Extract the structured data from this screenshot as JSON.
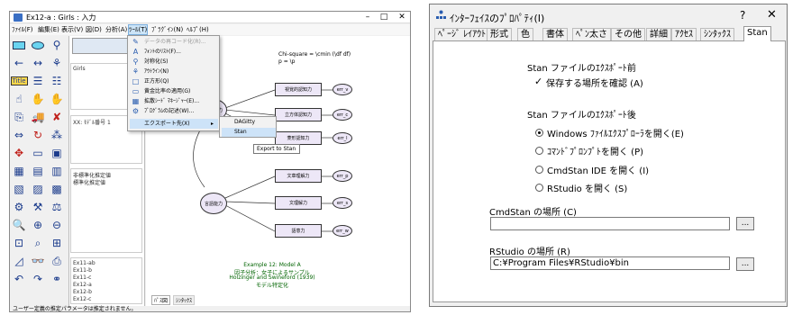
{
  "amos": {
    "title": "Ex12-a : Girls : 入力",
    "menu": [
      "ﾌｧｲﾙ(F)",
      "編集(E)",
      "表示(V)",
      "図(D)",
      "分析(A)",
      "ﾂｰﾙ(T)",
      "ﾌﾟﾗｸﾞｲﾝ(N)",
      "ﾍﾙﾌﾟ(H)"
    ],
    "panel": {
      "group": "Girls",
      "model": "XX: ﾓﾃﾞﾙ番号 1",
      "estimates": [
        "非標準化推定値",
        "標準化推定値"
      ],
      "files": [
        "Ex11-ab",
        "Ex11-b",
        "Ex11-c",
        "Ex12-a",
        "Ex12-b",
        "Ex12-c"
      ]
    },
    "tools_menu": {
      "items": [
        {
          "label": "データの再コード化(R)...",
          "disabled": true
        },
        {
          "label": "ﾌｫﾝﾄのﾘｽﾄ(F)..."
        },
        {
          "label": "対称化(S)"
        },
        {
          "label": "ｱｳﾄﾗｲﾝ(N)"
        },
        {
          "label": "正方形(Q)"
        },
        {
          "label": "黄金比率の適用(G)"
        },
        {
          "label": "拡散ｼｰﾄﾞ ﾏﾈｰｼﾞｬｰ(E)..."
        },
        {
          "label": "ﾌﾟﾛｸﾞﾗﾑの記述(W)..."
        },
        {
          "label": "エクスポート先(X)",
          "highlighted": true
        }
      ],
      "submenu": [
        "DAGitty",
        "Stan"
      ],
      "tooltip": "Export to Stan"
    },
    "diagram": {
      "header_lines": [
        "Chi-square = \\cmin (\\df df)",
        "p = \\p"
      ],
      "factors": [
        "空間能力",
        "言語能力"
      ],
      "observed": [
        "視覚的認知力",
        "立方体認知力",
        "菱形認知力",
        "文章理解力",
        "文理解力",
        "語意力"
      ],
      "errors": [
        "err_v",
        "err_c",
        "err_l",
        "err_p",
        "err_s",
        "err_w"
      ],
      "caption": [
        "Example 12: Model A",
        "因子分析：女子によるサンプル",
        "Holzinger and Swineford (1939)",
        "モデル特定化"
      ]
    },
    "canvas_tabs": [
      "ﾊﾟｽ図",
      "ｼﾝﾀｯｸｽ"
    ],
    "status": "ユーザー定義の推定パラメータは推定されません。"
  },
  "dialog": {
    "title": "ｲﾝﾀｰﾌｪｲｽのﾌﾟﾛﾊﾟﾃｨ(I)",
    "help": "?",
    "close": "✕",
    "tabs": [
      "ﾍﾟｰｼﾞ ﾚｲｱｳﾄ",
      "形式",
      "色",
      "書体",
      "ﾍﾟﾝ太さ",
      "その他",
      "詳細",
      "ｱｸｾｽ",
      "ｼﾝﾀｯｸｽ",
      "Stan"
    ],
    "selected_tab": "Stan",
    "export_before_heading": "Stan ファイルのｴｸｽﾎﾟｰﾄ前",
    "confirm_location_label": "保存する場所を確認 (A)",
    "confirm_location_checked": true,
    "export_after_heading": "Stan ファイルのｴｸｽﾎﾟｰﾄ後",
    "after_options": [
      {
        "label": "Windows ﾌｧｲﾙｴｸｽﾌﾟﾛｰﾗを開く(E)",
        "selected": true
      },
      {
        "label": "ｺﾏﾝﾄﾞﾌﾟﾛﾝﾌﾟﾄを開く (P)",
        "selected": false
      },
      {
        "label": "CmdStan IDE を開く (I)",
        "selected": false
      },
      {
        "label": "RStudio を開く (S)",
        "selected": false
      }
    ],
    "cmdstan_label": "CmdStan の場所 (C)",
    "cmdstan_value": "",
    "rstudio_label": "RStudio の場所 (R)",
    "rstudio_value": "C:¥Program Files¥RStudio¥bin",
    "browse_label": "..."
  }
}
